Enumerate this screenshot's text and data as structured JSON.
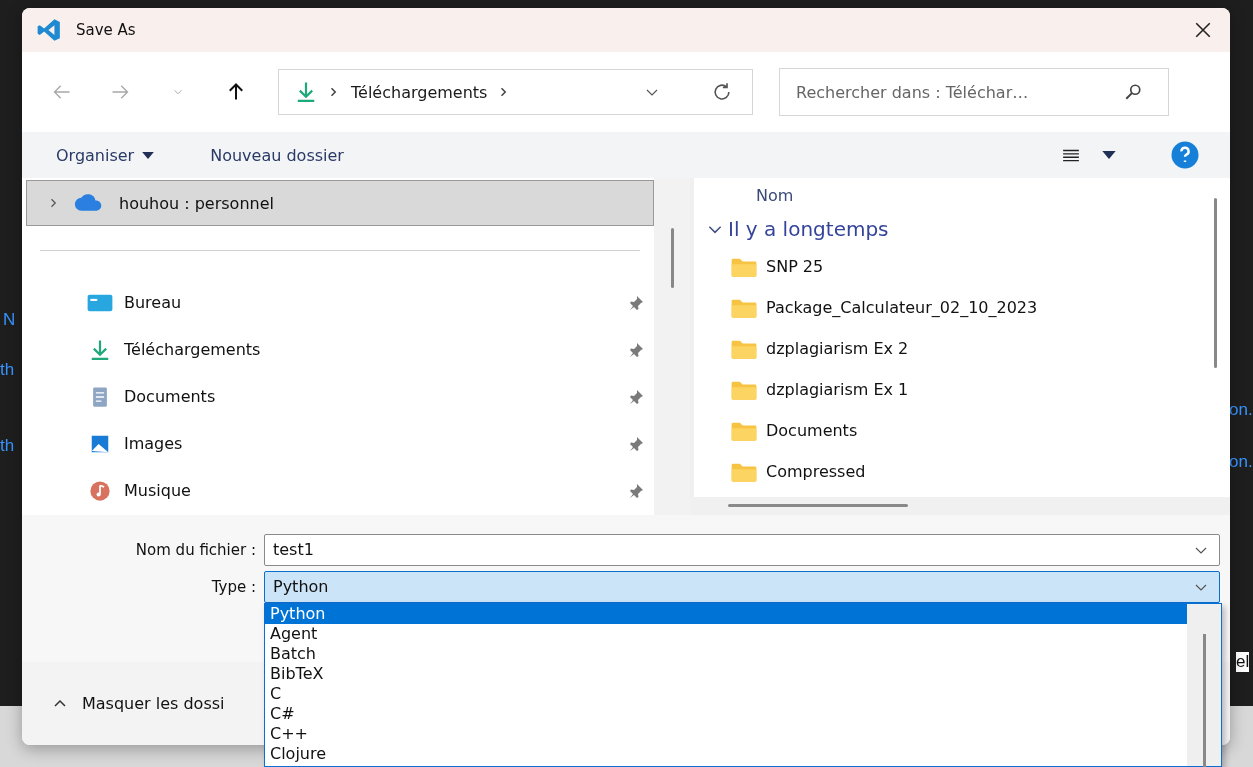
{
  "background_fragments": [
    {
      "text": "N"
    },
    {
      "text": "th"
    },
    {
      "text": "th"
    },
    {
      "text": "on."
    },
    {
      "text": "on."
    },
    {
      "text": "el"
    }
  ],
  "window": {
    "title": "Save As"
  },
  "nav_buttons": [
    {
      "kind": "back",
      "disabled": true
    },
    {
      "kind": "forward",
      "disabled": true
    },
    {
      "kind": "recent",
      "disabled": true
    },
    {
      "kind": "up",
      "disabled": false
    }
  ],
  "address": {
    "segments": [
      "Téléchargements"
    ]
  },
  "search": {
    "placeholder": "Rechercher dans : Téléchar…"
  },
  "toolbar": {
    "organize": "Organiser",
    "new_folder": "Nouveau dossier"
  },
  "nav_pane": {
    "root": {
      "label": "houhou : personnel",
      "selected": true,
      "expanded": false
    },
    "quick_access": [
      {
        "label": "Bureau",
        "kind": "desktop",
        "pinned": true
      },
      {
        "label": "Téléchargements",
        "kind": "downloads",
        "pinned": true
      },
      {
        "label": "Documents",
        "kind": "documents",
        "pinned": true
      },
      {
        "label": "Images",
        "kind": "pictures",
        "pinned": true
      },
      {
        "label": "Musique",
        "kind": "music",
        "pinned": true
      }
    ]
  },
  "file_list": {
    "column": "Nom",
    "groups": [
      {
        "label": "Il y a longtemps",
        "expanded": true,
        "items": [
          {
            "name": "SNP 25"
          },
          {
            "name": "Package_Calculateur_02_10_2023"
          },
          {
            "name": "dzplagiarism  Ex 2"
          },
          {
            "name": "dzplagiarism Ex 1"
          },
          {
            "name": "Documents"
          },
          {
            "name": "Compressed"
          }
        ]
      }
    ]
  },
  "form": {
    "filename_label": "Nom du fichier :",
    "filename": "test1",
    "type_label": "Type :",
    "type": "Python",
    "type_open": true
  },
  "type_options": [
    {
      "label": "Python",
      "selected": true
    },
    {
      "label": "Agent",
      "selected": false
    },
    {
      "label": "Batch",
      "selected": false
    },
    {
      "label": "BibTeX",
      "selected": false
    },
    {
      "label": "C",
      "selected": false
    },
    {
      "label": "C#",
      "selected": false
    },
    {
      "label": "C++",
      "selected": false
    },
    {
      "label": "Clojure",
      "selected": false
    }
  ],
  "footer": {
    "toggle": "Masquer les dossi"
  }
}
